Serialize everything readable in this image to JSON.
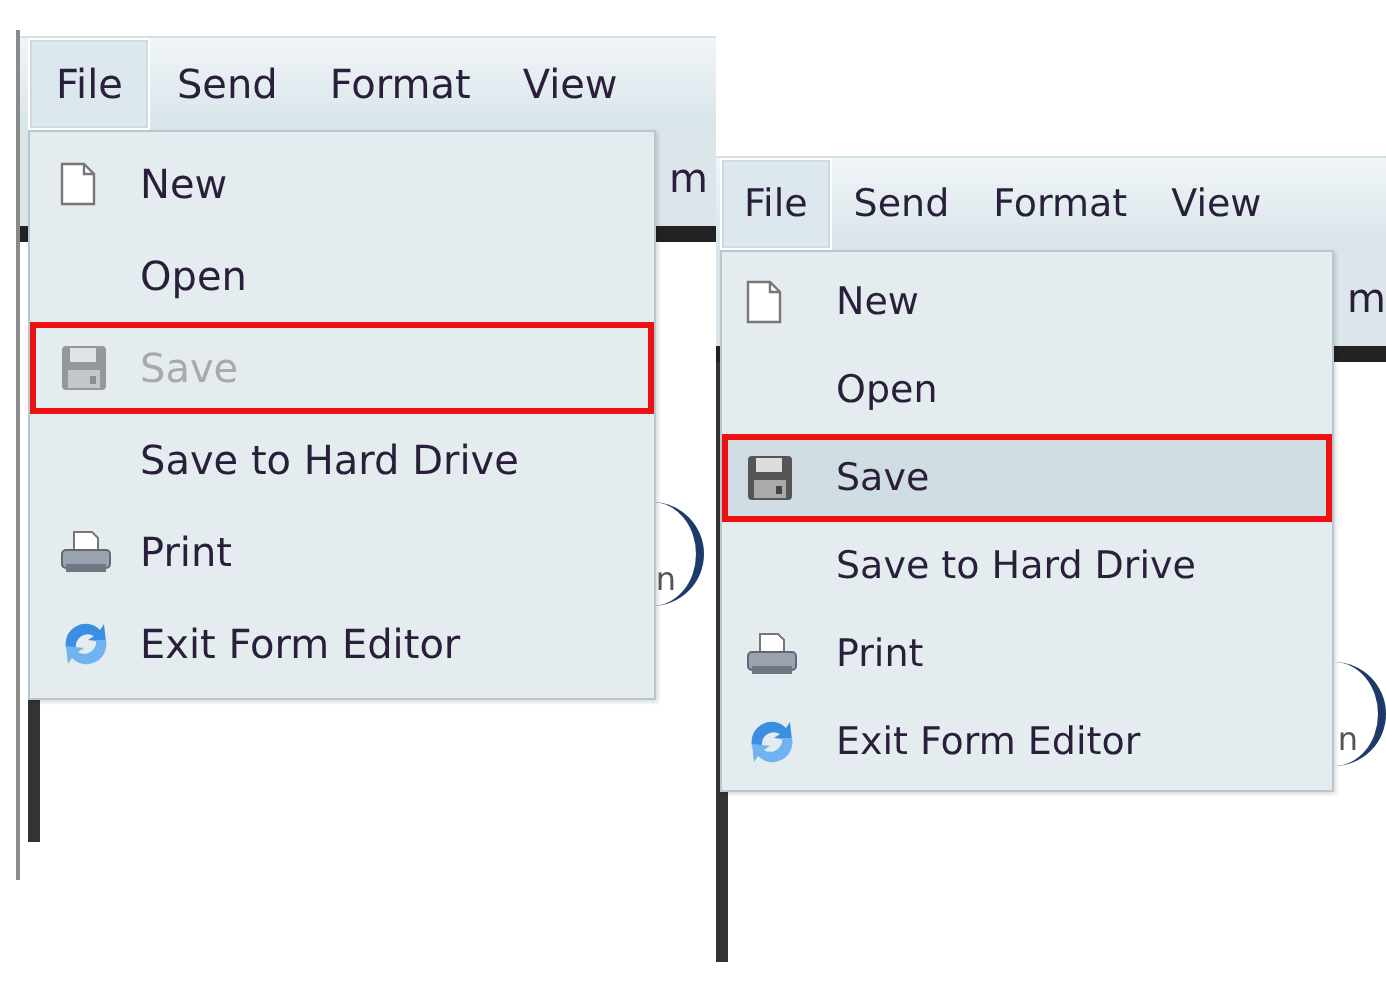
{
  "panels": [
    {
      "menubar": [
        {
          "label": "File",
          "open": true
        },
        {
          "label": "Send",
          "open": false
        },
        {
          "label": "Format",
          "open": false
        },
        {
          "label": "View",
          "open": false
        }
      ],
      "toolbar_fragment": "m",
      "logo_fragment": "n",
      "menu": [
        {
          "label": "New",
          "kind": "document",
          "disabled": false,
          "selected": false,
          "highlighted": false
        },
        {
          "label": "Open",
          "kind": "none",
          "disabled": false,
          "selected": false,
          "highlighted": false
        },
        {
          "label": "Save",
          "kind": "floppy",
          "disabled": true,
          "selected": false,
          "highlighted": true
        },
        {
          "label": "Save to Hard Drive",
          "kind": "none",
          "disabled": false,
          "selected": false,
          "highlighted": false
        },
        {
          "label": "Print",
          "kind": "printer",
          "disabled": false,
          "selected": false,
          "highlighted": false
        },
        {
          "label": "Exit Form Editor",
          "kind": "arrows",
          "disabled": false,
          "selected": false,
          "highlighted": false
        }
      ]
    },
    {
      "menubar": [
        {
          "label": "File",
          "open": true
        },
        {
          "label": "Send",
          "open": false
        },
        {
          "label": "Format",
          "open": false
        },
        {
          "label": "View",
          "open": false
        }
      ],
      "toolbar_fragment": "m",
      "logo_fragment": "n",
      "menu": [
        {
          "label": "New",
          "kind": "document",
          "disabled": false,
          "selected": false,
          "highlighted": false
        },
        {
          "label": "Open",
          "kind": "none",
          "disabled": false,
          "selected": false,
          "highlighted": false
        },
        {
          "label": "Save",
          "kind": "floppy",
          "disabled": false,
          "selected": true,
          "highlighted": true
        },
        {
          "label": "Save to Hard Drive",
          "kind": "none",
          "disabled": false,
          "selected": false,
          "highlighted": false
        },
        {
          "label": "Print",
          "kind": "printer",
          "disabled": false,
          "selected": false,
          "highlighted": false
        },
        {
          "label": "Exit Form Editor",
          "kind": "arrows",
          "disabled": false,
          "selected": false,
          "highlighted": false
        }
      ]
    }
  ]
}
